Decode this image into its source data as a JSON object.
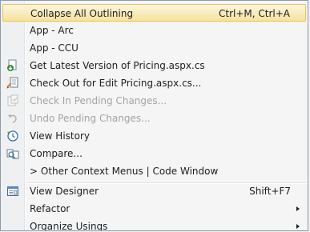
{
  "menu": {
    "items": [
      {
        "label": "Collapse All Outlining",
        "shortcut": "Ctrl+M, Ctrl+A"
      },
      {
        "label": "App - Arc"
      },
      {
        "label": "App - CCU"
      },
      {
        "label": "Get Latest Version of Pricing.aspx.cs",
        "icon": "get-latest-icon"
      },
      {
        "label": "Check Out for Edit Pricing.aspx.cs...",
        "icon": "check-out-icon"
      },
      {
        "label": "Check In Pending Changes...",
        "icon": "check-in-icon"
      },
      {
        "label": "Undo Pending Changes...",
        "icon": "undo-icon"
      },
      {
        "label": "View History",
        "icon": "history-icon"
      },
      {
        "label": "Compare...",
        "icon": "compare-icon"
      },
      {
        "label": "> Other Context Menus | Code Window"
      },
      {
        "label": "View Designer",
        "shortcut": "Shift+F7",
        "icon": "designer-icon"
      },
      {
        "label": "Refactor"
      },
      {
        "label": "Organize Usings"
      }
    ]
  },
  "colors": {
    "highlight_top": "#fcf5dd",
    "highlight_bottom": "#f6e39c",
    "highlight_border": "#e5c365",
    "disabled_text": "#a3a3a3"
  }
}
